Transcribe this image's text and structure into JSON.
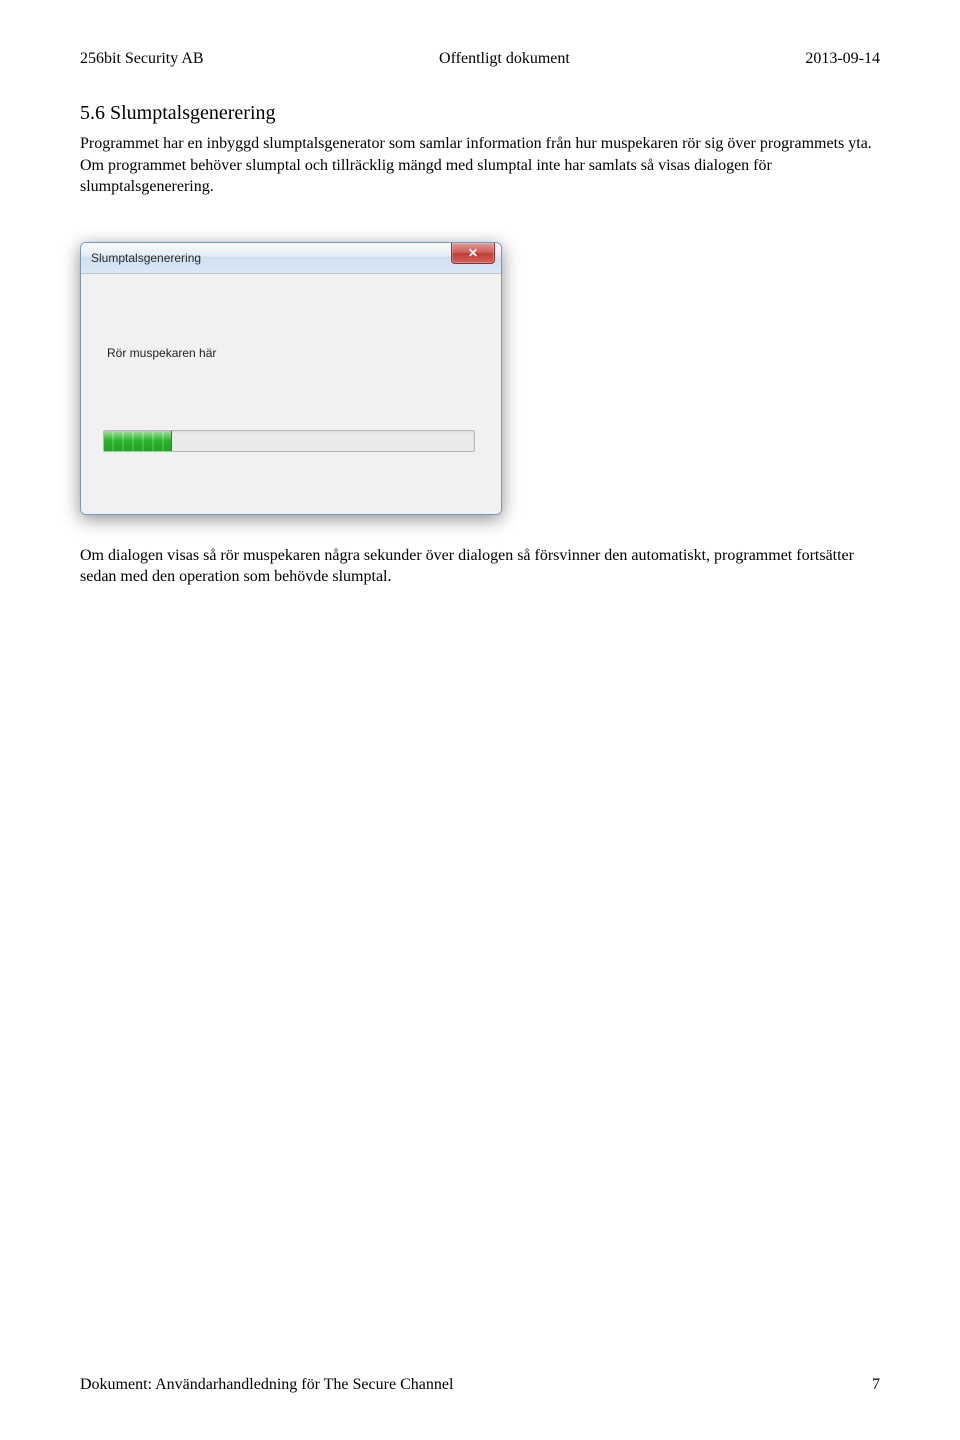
{
  "header": {
    "left": "256bit Security AB",
    "center": "Offentligt dokument",
    "right": "2013-09-14"
  },
  "section": {
    "title": "5.6 Slumptalsgenerering",
    "para1": "Programmet har en inbyggd slumptalsgenerator som samlar information från hur muspekaren rör sig över programmets yta. Om programmet behöver slumptal och tillräcklig mängd med slumptal inte har samlats så visas dialogen för slumptalsgenerering.",
    "para2": "Om dialogen visas så rör muspekaren några sekunder över dialogen så försvinner den automatiskt, programmet fortsätter sedan med den operation som behövde slumptal."
  },
  "dialog": {
    "title": "Slumptalsgenerering",
    "instruction": "Rör muspekaren här",
    "close_label": "✕",
    "progress_percent": 18
  },
  "footer": {
    "doc": "Dokument: Användarhandledning för The Secure Channel",
    "page": "7"
  }
}
